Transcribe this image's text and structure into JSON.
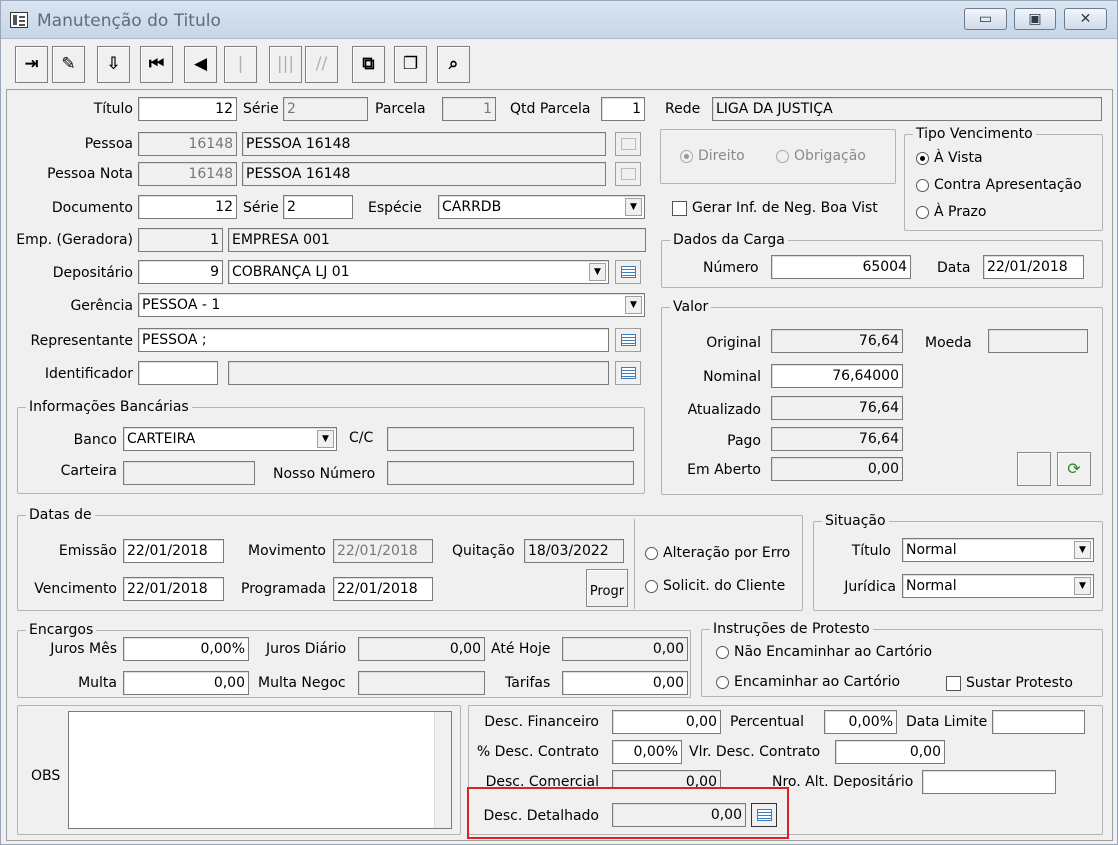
{
  "window": {
    "title": "Manutenção do Titulo",
    "btn_min": "▭",
    "btn_max": "▣",
    "btn_close": "✕"
  },
  "toolbar": {
    "b1": "⇥",
    "b2": "✎",
    "b3": "⇩",
    "b4": "⏮",
    "b5": "◀",
    "b6": "|",
    "b7": "|||",
    "b8": "//",
    "b9": "⧉",
    "b10": "❐",
    "b11": "⌕"
  },
  "titulo": {
    "label": "Título",
    "value": "12",
    "serie_label": "Série",
    "serie": "2",
    "parcela_label": "Parcela",
    "parcela": "1",
    "qtd_label": "Qtd Parcela",
    "qtd": "1"
  },
  "rede": {
    "label": "Rede",
    "value": "LIGA DA JUSTIÇA"
  },
  "pessoa": {
    "label": "Pessoa",
    "code": "16148",
    "name": "PESSOA 16148"
  },
  "pessoa_nota": {
    "label": "Pessoa Nota",
    "code": "16148",
    "name": "PESSOA 16148"
  },
  "tipo_pessoa": {
    "direito": "Direito",
    "obrigacao": "Obrigação"
  },
  "tipo_vencimento": {
    "title": "Tipo Vencimento",
    "a_vista": "À Vista",
    "contra": "Contra Apresentação",
    "a_prazo": "À Prazo"
  },
  "documento": {
    "label": "Documento",
    "value": "12",
    "serie_label": "Série",
    "serie": "2",
    "especie_label": "Espécie",
    "especie": "CARRDB"
  },
  "gerar": {
    "label": "Gerar Inf. de Neg. Boa Vist"
  },
  "emp": {
    "label": "Emp. (Geradora)",
    "code": "1",
    "name": "EMPRESA 001"
  },
  "depositario": {
    "label": "Depositário",
    "code": "9",
    "name": "COBRANÇA LJ 01"
  },
  "gerencia": {
    "label": "Gerência",
    "value": "PESSOA - 1"
  },
  "representante": {
    "label": "Representante",
    "value": "PESSOA ;"
  },
  "identificador": {
    "label": "Identificador",
    "value": "",
    "desc": ""
  },
  "carga": {
    "title": "Dados da Carga",
    "numero_label": "Número",
    "numero": "65004",
    "data_label": "Data",
    "data": "22/01/2018"
  },
  "valor": {
    "title": "Valor",
    "original_label": "Original",
    "original": "76,64",
    "moeda_label": "Moeda",
    "moeda": "",
    "nominal_label": "Nominal",
    "nominal": "76,64000",
    "atualizado_label": "Atualizado",
    "atualizado": "76,64",
    "pago_label": "Pago",
    "pago": "76,64",
    "aberto_label": "Em Aberto",
    "aberto": "0,00"
  },
  "banco": {
    "title": "Informações Bancárias",
    "banco_label": "Banco",
    "banco": "CARTEIRA",
    "cc_label": "C/C",
    "cc": "",
    "carteira_label": "Carteira",
    "carteira": "",
    "nosso_label": "Nosso Número",
    "nosso": ""
  },
  "datas": {
    "title": "Datas de",
    "emissao_label": "Emissão",
    "emissao": "22/01/2018",
    "movimento_label": "Movimento",
    "movimento": "22/01/2018",
    "quitacao_label": "Quitação",
    "quitacao": "18/03/2022",
    "vencimento_label": "Vencimento",
    "vencimento": "22/01/2018",
    "programada_label": "Programada",
    "programada": "22/01/2018",
    "progr_btn": "Progr",
    "alteracao": "Alteração por Erro",
    "solicit": "Solicit. do Cliente"
  },
  "situacao": {
    "title": "Situação",
    "titulo_label": "Título",
    "titulo": "Normal",
    "juridica_label": "Jurídica",
    "juridica": "Normal"
  },
  "encargos": {
    "title": "Encargos",
    "juros_mes_label": "Juros Mês",
    "juros_mes": "0,00%",
    "juros_dia_label": "Juros Diário",
    "juros_dia": "0,00",
    "ate_hoje_label": "Até Hoje",
    "ate_hoje": "0,00",
    "multa_label": "Multa",
    "multa": "0,00",
    "multa_neg_label": "Multa Negoc",
    "multa_neg": "",
    "tarifas_label": "Tarifas",
    "tarifas": "0,00"
  },
  "protesto": {
    "title": "Instruções de Protesto",
    "nao": "Não Encaminhar ao Cartório",
    "sim": "Encaminhar ao Cartório",
    "sustar": "Sustar Protesto"
  },
  "obs": {
    "label": "OBS",
    "value": ""
  },
  "desc": {
    "fin_label": "Desc. Financeiro",
    "fin": "0,00",
    "perc_label": "Percentual",
    "perc": "0,00%",
    "limite_label": "Data Limite",
    "limite": "",
    "contrato_pct_label": "% Desc. Contrato",
    "contrato_pct": "0,00%",
    "vlr_contrato_label": "Vlr. Desc. Contrato",
    "vlr_contrato": "0,00",
    "comercial_label": "Desc. Comercial",
    "comercial": "0,00",
    "nro_alt_label": "Nro. Alt. Depositário",
    "nro_alt": "",
    "detalhado_label": "Desc. Detalhado",
    "detalhado": "0,00"
  }
}
